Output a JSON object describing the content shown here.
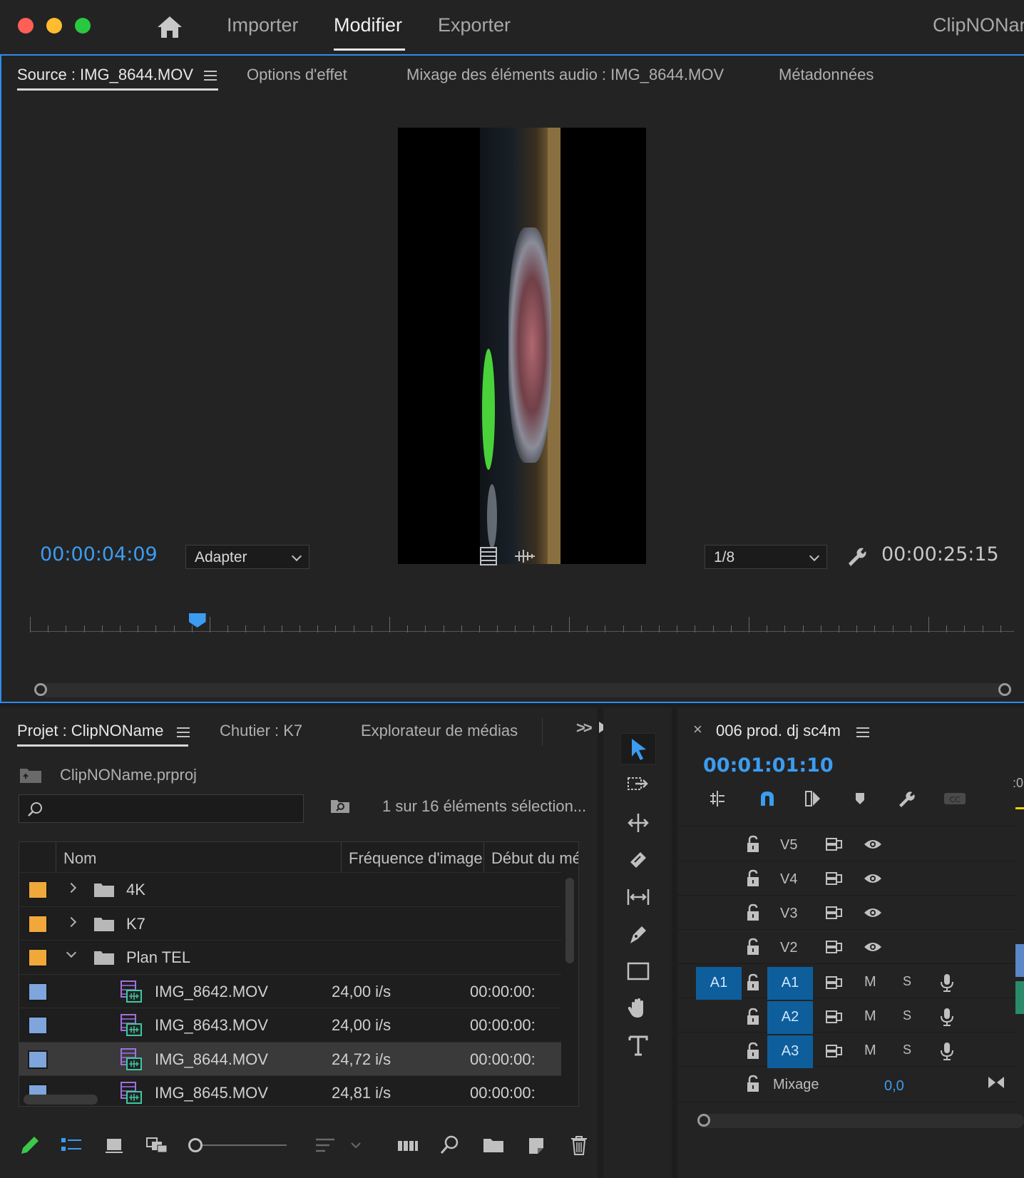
{
  "topbar": {
    "tabs": [
      "Importer",
      "Modifier",
      "Exporter"
    ],
    "active_tab": "Modifier",
    "app_name": "ClipNONam"
  },
  "source_panel": {
    "tabs": [
      "Source : IMG_8644.MOV",
      "Options d'effet",
      "Mixage des éléments audio : IMG_8644.MOV",
      "Métadonnées"
    ],
    "current_timecode": "00:00:04:09",
    "zoom_value": "Adapter",
    "resolution_value": "1/8",
    "duration_timecode": "00:00:25:15",
    "playhead_fraction": 0.17
  },
  "project_panel": {
    "tabs": [
      "Projet : ClipNOName",
      "Chutier : K7",
      "Explorateur de médias"
    ],
    "overflow_icon": ">>",
    "project_file": "ClipNOName.prproj",
    "search_placeholder": "",
    "selection_status": "1 sur 16 éléments sélection...",
    "columns": [
      "Nom",
      "Fréquence d'image",
      "Début du mé"
    ],
    "rows": [
      {
        "type": "folder",
        "name": "4K",
        "color": "#f0a83a",
        "expanded": false,
        "fps": "",
        "start": ""
      },
      {
        "type": "folder",
        "name": "K7",
        "color": "#f0a83a",
        "expanded": false,
        "fps": "",
        "start": ""
      },
      {
        "type": "folder",
        "name": "Plan TEL",
        "color": "#f0a83a",
        "expanded": true,
        "fps": "",
        "start": ""
      },
      {
        "type": "clip",
        "name": "IMG_8642.MOV",
        "color": "#7fa6dc",
        "fps": "24,00 i/s",
        "start": "00:00:00:"
      },
      {
        "type": "clip",
        "name": "IMG_8643.MOV",
        "color": "#7fa6dc",
        "fps": "24,00 i/s",
        "start": "00:00:00:"
      },
      {
        "type": "clip",
        "name": "IMG_8644.MOV",
        "color": "#7fa6dc",
        "fps": "24,72 i/s",
        "start": "00:00:00:",
        "selected": true
      },
      {
        "type": "clip",
        "name": "IMG_8645.MOV",
        "color": "#7fa6dc",
        "fps": "24,81 i/s",
        "start": "00:00:00:"
      }
    ]
  },
  "timeline_panel": {
    "close_icon": "×",
    "sequence_name": "006 prod. dj sc4m",
    "timecode": "00:01:01:10",
    "ruler_label": ":0",
    "video_tracks": [
      "V5",
      "V4",
      "V3",
      "V2"
    ],
    "audio_tracks": [
      {
        "source": "A1",
        "name": "A1",
        "mute": "M",
        "solo": "S"
      },
      {
        "source": "",
        "name": "A2",
        "mute": "M",
        "solo": "S"
      },
      {
        "source": "",
        "name": "A3",
        "mute": "M",
        "solo": "S"
      }
    ],
    "mix_label": "Mixage",
    "mix_value": "0,0"
  },
  "colors": {
    "accent_blue": "#3c9cf0",
    "track_target_blue": "#0e5e9c",
    "folder_label": "#f0a83a",
    "clip_label": "#7fa6dc"
  }
}
